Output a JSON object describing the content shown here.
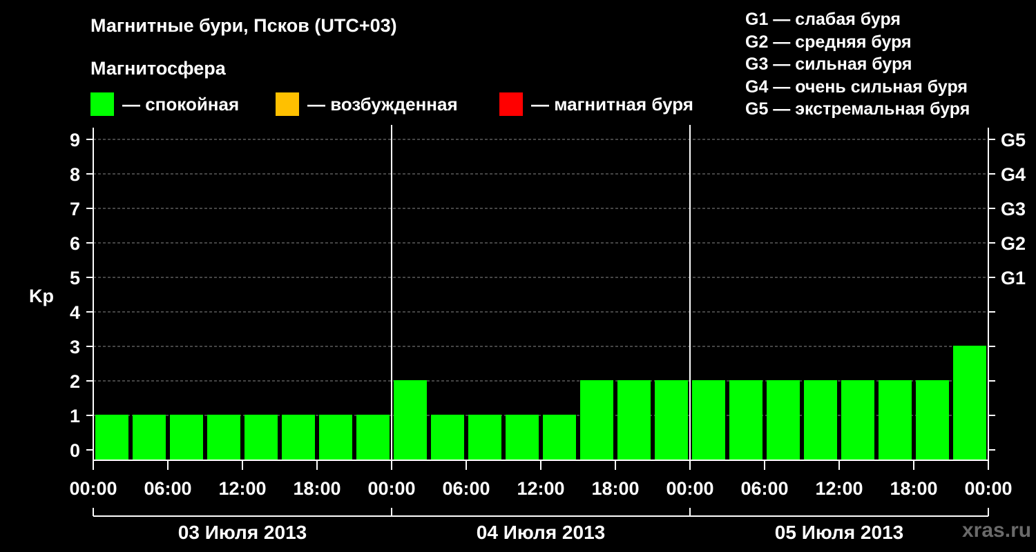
{
  "title": "Магнитные бури, Псков (UTC+03)",
  "subtitle": "Магнитосфера",
  "legend": [
    {
      "color": "#00ff00",
      "label": "— спокойная"
    },
    {
      "color": "#ffc000",
      "label": "— возбужденная"
    },
    {
      "color": "#ff0000",
      "label": "— магнитная буря"
    }
  ],
  "g_scale": [
    "G1 — слабая буря",
    "G2 — средняя буря",
    "G3 — сильная буря",
    "G4 — очень сильная буря",
    "G5 — экстремальная буря"
  ],
  "watermark": "xras.ru",
  "chart_data": {
    "type": "bar",
    "ylabel": "Kp",
    "ylim": [
      0,
      9
    ],
    "yticks": [
      "0",
      "1",
      "2",
      "3",
      "4",
      "5",
      "6",
      "7",
      "8",
      "9"
    ],
    "right_ticks": [
      {
        "value": 5,
        "label": "G1"
      },
      {
        "value": 6,
        "label": "G2"
      },
      {
        "value": 7,
        "label": "G3"
      },
      {
        "value": 8,
        "label": "G4"
      },
      {
        "value": 9,
        "label": "G5"
      }
    ],
    "xtick_labels": [
      "00:00",
      "06:00",
      "12:00",
      "18:00",
      "00:00",
      "06:00",
      "12:00",
      "18:00",
      "00:00",
      "06:00",
      "12:00",
      "18:00",
      "00:00"
    ],
    "days": [
      "03 Июля 2013",
      "04 Июля 2013",
      "05 Июля 2013"
    ],
    "bar_interval_hours": 3,
    "values": [
      1,
      1,
      1,
      1,
      1,
      1,
      1,
      1,
      2,
      1,
      1,
      1,
      1,
      2,
      2,
      2,
      2,
      2,
      2,
      2,
      2,
      2,
      2,
      3
    ],
    "bar_color": "#00ff00",
    "grid": true
  }
}
